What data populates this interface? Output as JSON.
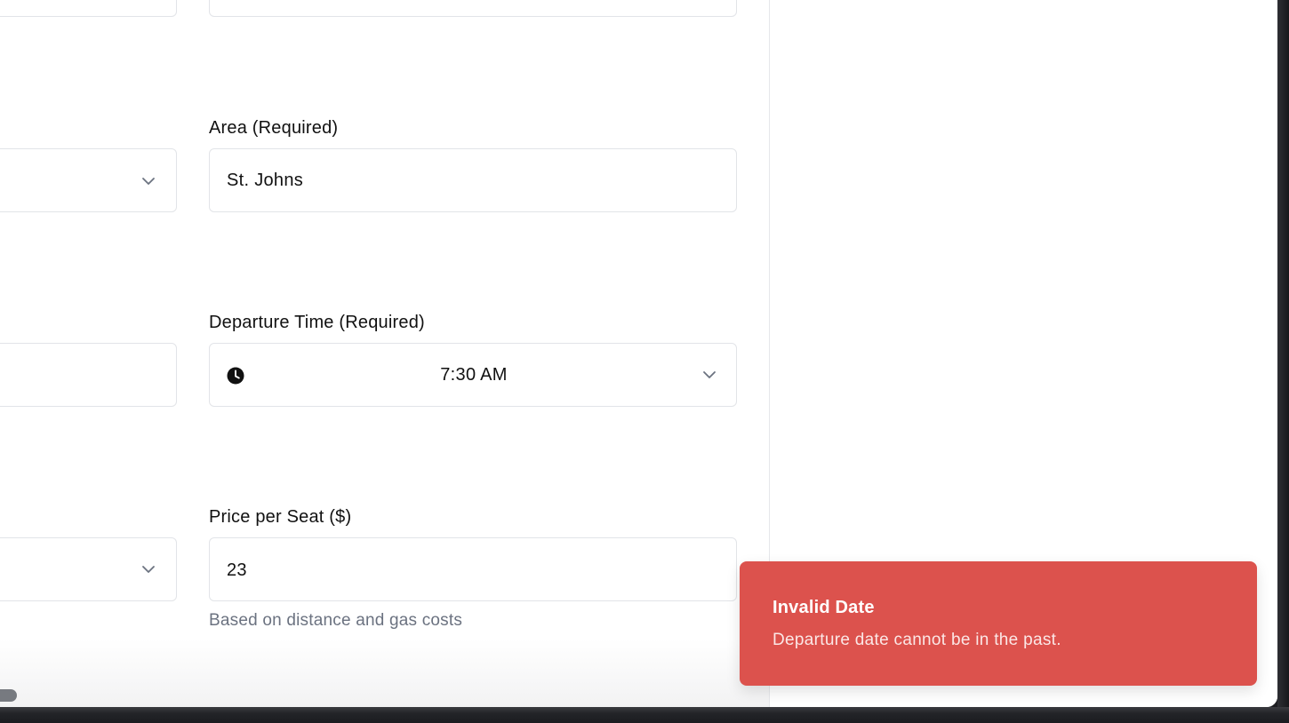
{
  "form": {
    "area": {
      "label": "Area (Required)",
      "value": "St. Johns"
    },
    "departure_time": {
      "label": "Departure Time (Required)",
      "value": "7:30 AM"
    },
    "price": {
      "label": "Price per Seat ($)",
      "value": "23",
      "helper": "Based on distance and gas costs"
    }
  },
  "toast": {
    "title": "Invalid Date",
    "description": "Departure date cannot be in the past.",
    "background": "#dc524d"
  },
  "icons": {
    "dropdown": "chevron-down-icon",
    "time": "clock-icon"
  }
}
